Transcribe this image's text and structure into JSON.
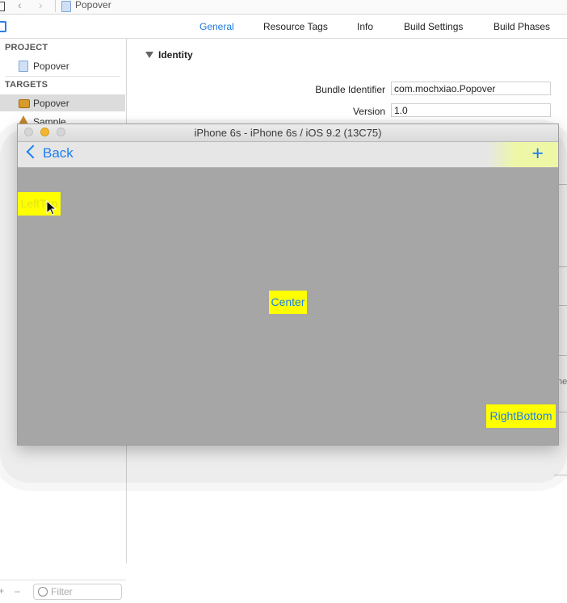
{
  "topbar": {
    "breadcrumb": "Popover"
  },
  "tabs": [
    {
      "label": "General"
    },
    {
      "label": "Resource Tags"
    },
    {
      "label": "Info"
    },
    {
      "label": "Build Settings"
    },
    {
      "label": "Build Phases"
    }
  ],
  "sidebar": {
    "project_header": "PROJECT",
    "project_item": "Popover",
    "targets_header": "TARGETS",
    "targets": [
      {
        "label": "Popover"
      },
      {
        "label": "Sample"
      }
    ],
    "filter_placeholder": "Filter"
  },
  "identity": {
    "section_title": "Identity",
    "bundle_identifier_label": "Bundle Identifier",
    "bundle_identifier_value": "com.mochxiao.Popover",
    "version_label": "Version",
    "version_value": "1.0"
  },
  "right_edge_text": "he",
  "simulator": {
    "window_title": "iPhone 6s - iPhone 6s / iOS 9.2 (13C75)",
    "back_label": "Back",
    "plus_label": "+",
    "buttons": {
      "left_top": "LeftTop",
      "center": "Center",
      "right_bottom": "RightBottom"
    }
  },
  "colors": {
    "accent": "#1a7ef2",
    "button_yellow": "#ffff00",
    "simulator_bg": "#a6a6a6"
  }
}
